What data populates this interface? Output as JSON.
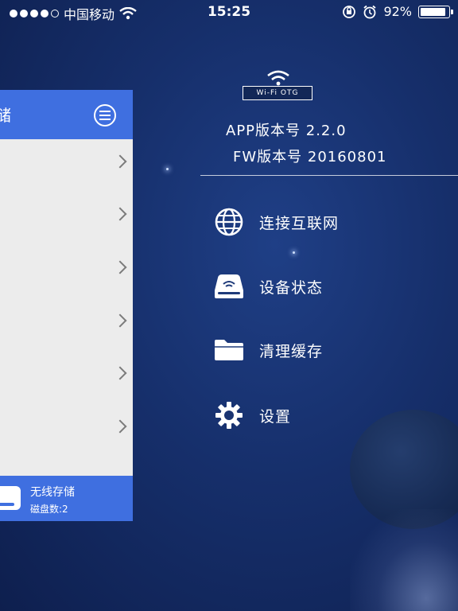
{
  "status_bar": {
    "carrier": "中国移动",
    "time": "15:25",
    "battery_percent": "92%",
    "battery_level": 0.92
  },
  "side_panel": {
    "header_title": "储",
    "menu_icon": "hamburger-menu-icon",
    "rows": 6,
    "footer": {
      "title": "无线存储",
      "subtitle": "磁盘数:2"
    }
  },
  "device": {
    "badge": "Wi-Fi OTG",
    "app_version": "APP版本号  2.2.0",
    "fw_version": "FW版本号  20160801"
  },
  "menu": {
    "items": [
      {
        "label": "连接互联网",
        "icon": "globe-icon"
      },
      {
        "label": "设备状态",
        "icon": "drive-icon"
      },
      {
        "label": "清理缓存",
        "icon": "folder-icon"
      },
      {
        "label": "设置",
        "icon": "gear-icon"
      }
    ]
  },
  "colors": {
    "accent_blue": "#3f6fe0",
    "background": "#162f6b",
    "panel": "#ececec"
  }
}
